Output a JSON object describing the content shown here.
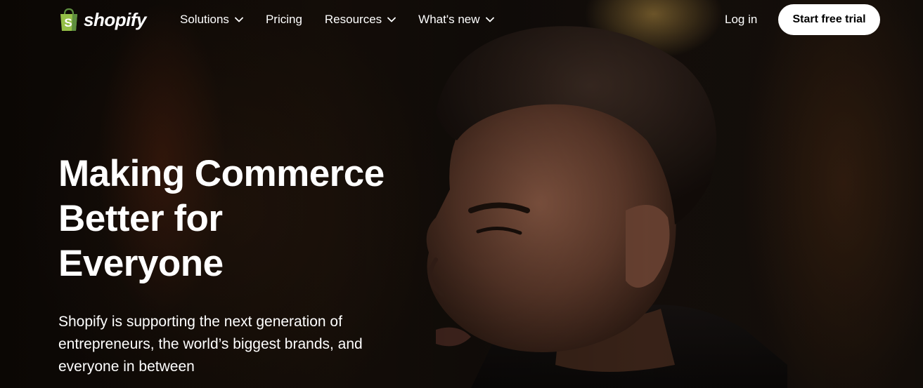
{
  "header": {
    "logo": {
      "wordmark": "shopify",
      "icon": "shopping-bag-logo-icon",
      "bag_color": "#95bf47",
      "bag_letter": "S"
    },
    "nav": [
      {
        "label": "Solutions",
        "has_dropdown": true,
        "icon": "chevron-down-icon"
      },
      {
        "label": "Pricing",
        "has_dropdown": false
      },
      {
        "label": "Resources",
        "has_dropdown": true,
        "icon": "chevron-down-icon"
      },
      {
        "label": "What's new",
        "has_dropdown": true,
        "icon": "chevron-down-icon"
      }
    ],
    "login_label": "Log in",
    "cta_label": "Start free trial"
  },
  "hero": {
    "title_lines": [
      "Making Commerce",
      "Better for",
      "Everyone"
    ],
    "subtitle_lines": [
      "Shopify is supporting the next generation of",
      "entrepreneurs, the world’s biggest brands, and",
      "everyone in between"
    ],
    "background": "video-still-man-portrait"
  },
  "colors": {
    "brand_green": "#95bf47",
    "text": "#ffffff",
    "cta_bg": "#ffffff",
    "cta_text": "#000000",
    "background": "#0e0b08"
  }
}
